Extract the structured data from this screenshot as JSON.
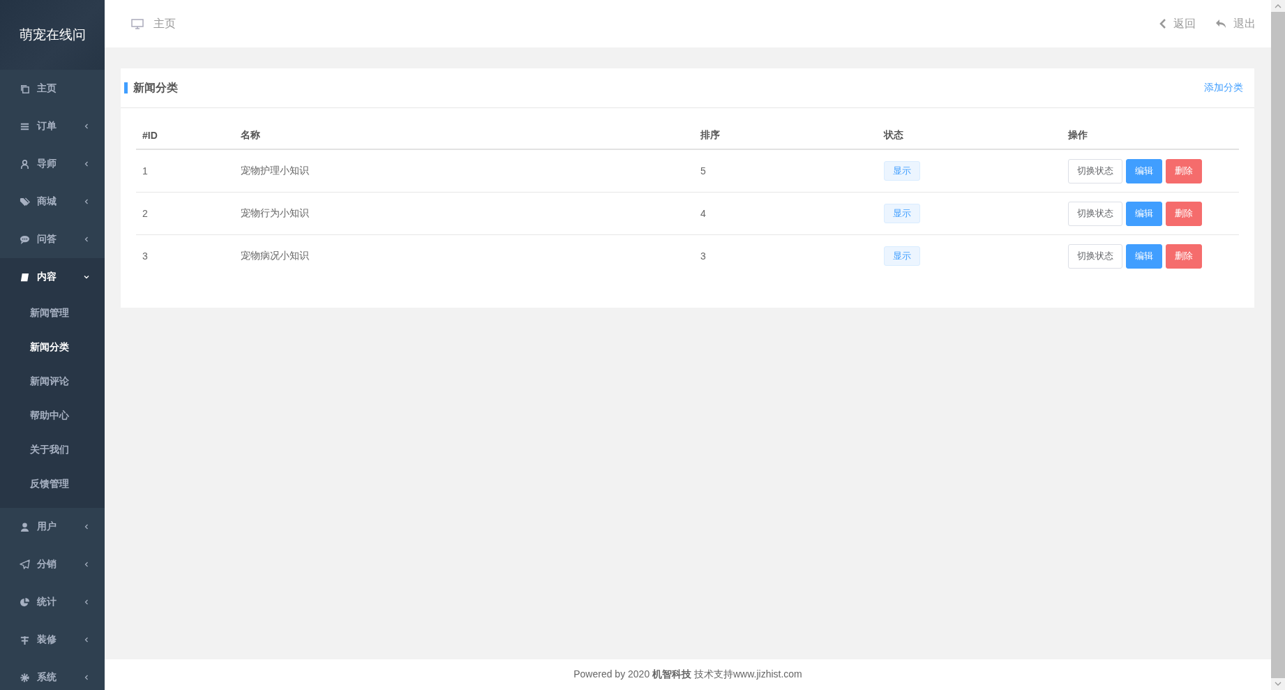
{
  "sidebar": {
    "logo": "萌宠在线问",
    "items": [
      {
        "label": "主页",
        "kind": "link"
      },
      {
        "label": "订单",
        "kind": "menu",
        "expanded": false
      },
      {
        "label": "导师",
        "kind": "menu",
        "expanded": false
      },
      {
        "label": "商城",
        "kind": "menu",
        "expanded": false
      },
      {
        "label": "问答",
        "kind": "menu",
        "expanded": false
      },
      {
        "label": "内容",
        "kind": "menu",
        "expanded": true,
        "children": [
          {
            "label": "新闻管理",
            "selected": false
          },
          {
            "label": "新闻分类",
            "selected": true
          },
          {
            "label": "新闻评论",
            "selected": false
          },
          {
            "label": "帮助中心",
            "selected": false
          },
          {
            "label": "关于我们",
            "selected": false
          },
          {
            "label": "反馈管理",
            "selected": false
          }
        ]
      },
      {
        "label": "用户",
        "kind": "menu",
        "expanded": false
      },
      {
        "label": "分销",
        "kind": "menu",
        "expanded": false
      },
      {
        "label": "统计",
        "kind": "menu",
        "expanded": false
      },
      {
        "label": "装修",
        "kind": "menu",
        "expanded": false
      },
      {
        "label": "系统",
        "kind": "menu",
        "expanded": false
      }
    ]
  },
  "header": {
    "breadcrumb": "主页",
    "back": "返回",
    "logout": "退出"
  },
  "card": {
    "title": "新闻分类",
    "add_link": "添加分类",
    "table": {
      "columns": [
        "#ID",
        "名称",
        "排序",
        "状态",
        "操作"
      ],
      "rows": [
        {
          "id": "1",
          "name": "宠物护理小知识",
          "sort": "5",
          "status": "显示",
          "actions": [
            {
              "label": "切换状态",
              "kind": "plain"
            },
            {
              "label": "编辑",
              "kind": "primary"
            },
            {
              "label": "删除",
              "kind": "danger"
            }
          ]
        },
        {
          "id": "2",
          "name": "宠物行为小知识",
          "sort": "4",
          "status": "显示",
          "actions": [
            {
              "label": "切换状态",
              "kind": "plain"
            },
            {
              "label": "编辑",
              "kind": "primary"
            },
            {
              "label": "删除",
              "kind": "danger"
            }
          ]
        },
        {
          "id": "3",
          "name": "宠物病况小知识",
          "sort": "3",
          "status": "显示",
          "actions": [
            {
              "label": "切换状态",
              "kind": "plain"
            },
            {
              "label": "编辑",
              "kind": "primary"
            },
            {
              "label": "删除",
              "kind": "danger"
            }
          ]
        }
      ]
    }
  },
  "footer": "Powered by 2020 **机智科技** 技术支持www.jizhist.com"
}
